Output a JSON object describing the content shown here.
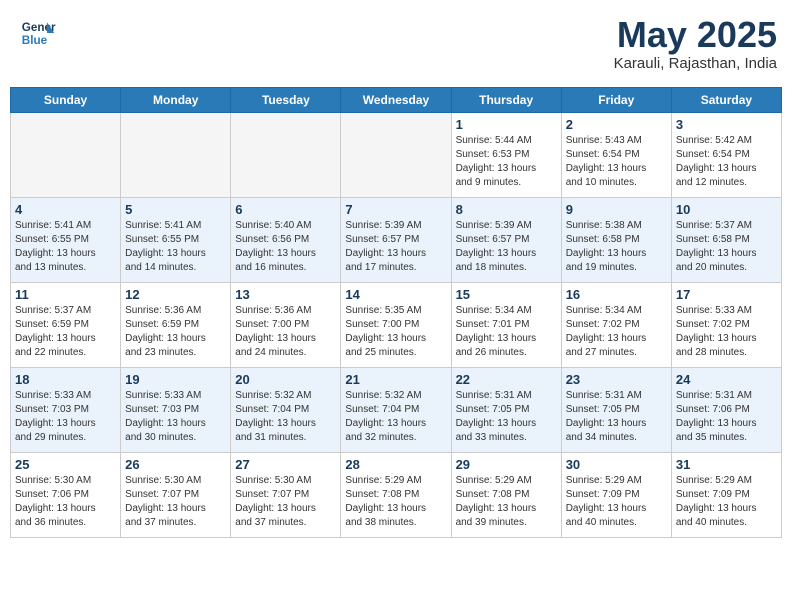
{
  "logo": {
    "line1": "General",
    "line2": "Blue"
  },
  "title": "May 2025",
  "location": "Karauli, Rajasthan, India",
  "days_of_week": [
    "Sunday",
    "Monday",
    "Tuesday",
    "Wednesday",
    "Thursday",
    "Friday",
    "Saturday"
  ],
  "weeks": [
    [
      {
        "day": "",
        "info": ""
      },
      {
        "day": "",
        "info": ""
      },
      {
        "day": "",
        "info": ""
      },
      {
        "day": "",
        "info": ""
      },
      {
        "day": "1",
        "info": "Sunrise: 5:44 AM\nSunset: 6:53 PM\nDaylight: 13 hours\nand 9 minutes."
      },
      {
        "day": "2",
        "info": "Sunrise: 5:43 AM\nSunset: 6:54 PM\nDaylight: 13 hours\nand 10 minutes."
      },
      {
        "day": "3",
        "info": "Sunrise: 5:42 AM\nSunset: 6:54 PM\nDaylight: 13 hours\nand 12 minutes."
      }
    ],
    [
      {
        "day": "4",
        "info": "Sunrise: 5:41 AM\nSunset: 6:55 PM\nDaylight: 13 hours\nand 13 minutes."
      },
      {
        "day": "5",
        "info": "Sunrise: 5:41 AM\nSunset: 6:55 PM\nDaylight: 13 hours\nand 14 minutes."
      },
      {
        "day": "6",
        "info": "Sunrise: 5:40 AM\nSunset: 6:56 PM\nDaylight: 13 hours\nand 16 minutes."
      },
      {
        "day": "7",
        "info": "Sunrise: 5:39 AM\nSunset: 6:57 PM\nDaylight: 13 hours\nand 17 minutes."
      },
      {
        "day": "8",
        "info": "Sunrise: 5:39 AM\nSunset: 6:57 PM\nDaylight: 13 hours\nand 18 minutes."
      },
      {
        "day": "9",
        "info": "Sunrise: 5:38 AM\nSunset: 6:58 PM\nDaylight: 13 hours\nand 19 minutes."
      },
      {
        "day": "10",
        "info": "Sunrise: 5:37 AM\nSunset: 6:58 PM\nDaylight: 13 hours\nand 20 minutes."
      }
    ],
    [
      {
        "day": "11",
        "info": "Sunrise: 5:37 AM\nSunset: 6:59 PM\nDaylight: 13 hours\nand 22 minutes."
      },
      {
        "day": "12",
        "info": "Sunrise: 5:36 AM\nSunset: 6:59 PM\nDaylight: 13 hours\nand 23 minutes."
      },
      {
        "day": "13",
        "info": "Sunrise: 5:36 AM\nSunset: 7:00 PM\nDaylight: 13 hours\nand 24 minutes."
      },
      {
        "day": "14",
        "info": "Sunrise: 5:35 AM\nSunset: 7:00 PM\nDaylight: 13 hours\nand 25 minutes."
      },
      {
        "day": "15",
        "info": "Sunrise: 5:34 AM\nSunset: 7:01 PM\nDaylight: 13 hours\nand 26 minutes."
      },
      {
        "day": "16",
        "info": "Sunrise: 5:34 AM\nSunset: 7:02 PM\nDaylight: 13 hours\nand 27 minutes."
      },
      {
        "day": "17",
        "info": "Sunrise: 5:33 AM\nSunset: 7:02 PM\nDaylight: 13 hours\nand 28 minutes."
      }
    ],
    [
      {
        "day": "18",
        "info": "Sunrise: 5:33 AM\nSunset: 7:03 PM\nDaylight: 13 hours\nand 29 minutes."
      },
      {
        "day": "19",
        "info": "Sunrise: 5:33 AM\nSunset: 7:03 PM\nDaylight: 13 hours\nand 30 minutes."
      },
      {
        "day": "20",
        "info": "Sunrise: 5:32 AM\nSunset: 7:04 PM\nDaylight: 13 hours\nand 31 minutes."
      },
      {
        "day": "21",
        "info": "Sunrise: 5:32 AM\nSunset: 7:04 PM\nDaylight: 13 hours\nand 32 minutes."
      },
      {
        "day": "22",
        "info": "Sunrise: 5:31 AM\nSunset: 7:05 PM\nDaylight: 13 hours\nand 33 minutes."
      },
      {
        "day": "23",
        "info": "Sunrise: 5:31 AM\nSunset: 7:05 PM\nDaylight: 13 hours\nand 34 minutes."
      },
      {
        "day": "24",
        "info": "Sunrise: 5:31 AM\nSunset: 7:06 PM\nDaylight: 13 hours\nand 35 minutes."
      }
    ],
    [
      {
        "day": "25",
        "info": "Sunrise: 5:30 AM\nSunset: 7:06 PM\nDaylight: 13 hours\nand 36 minutes."
      },
      {
        "day": "26",
        "info": "Sunrise: 5:30 AM\nSunset: 7:07 PM\nDaylight: 13 hours\nand 37 minutes."
      },
      {
        "day": "27",
        "info": "Sunrise: 5:30 AM\nSunset: 7:07 PM\nDaylight: 13 hours\nand 37 minutes."
      },
      {
        "day": "28",
        "info": "Sunrise: 5:29 AM\nSunset: 7:08 PM\nDaylight: 13 hours\nand 38 minutes."
      },
      {
        "day": "29",
        "info": "Sunrise: 5:29 AM\nSunset: 7:08 PM\nDaylight: 13 hours\nand 39 minutes."
      },
      {
        "day": "30",
        "info": "Sunrise: 5:29 AM\nSunset: 7:09 PM\nDaylight: 13 hours\nand 40 minutes."
      },
      {
        "day": "31",
        "info": "Sunrise: 5:29 AM\nSunset: 7:09 PM\nDaylight: 13 hours\nand 40 minutes."
      }
    ]
  ]
}
